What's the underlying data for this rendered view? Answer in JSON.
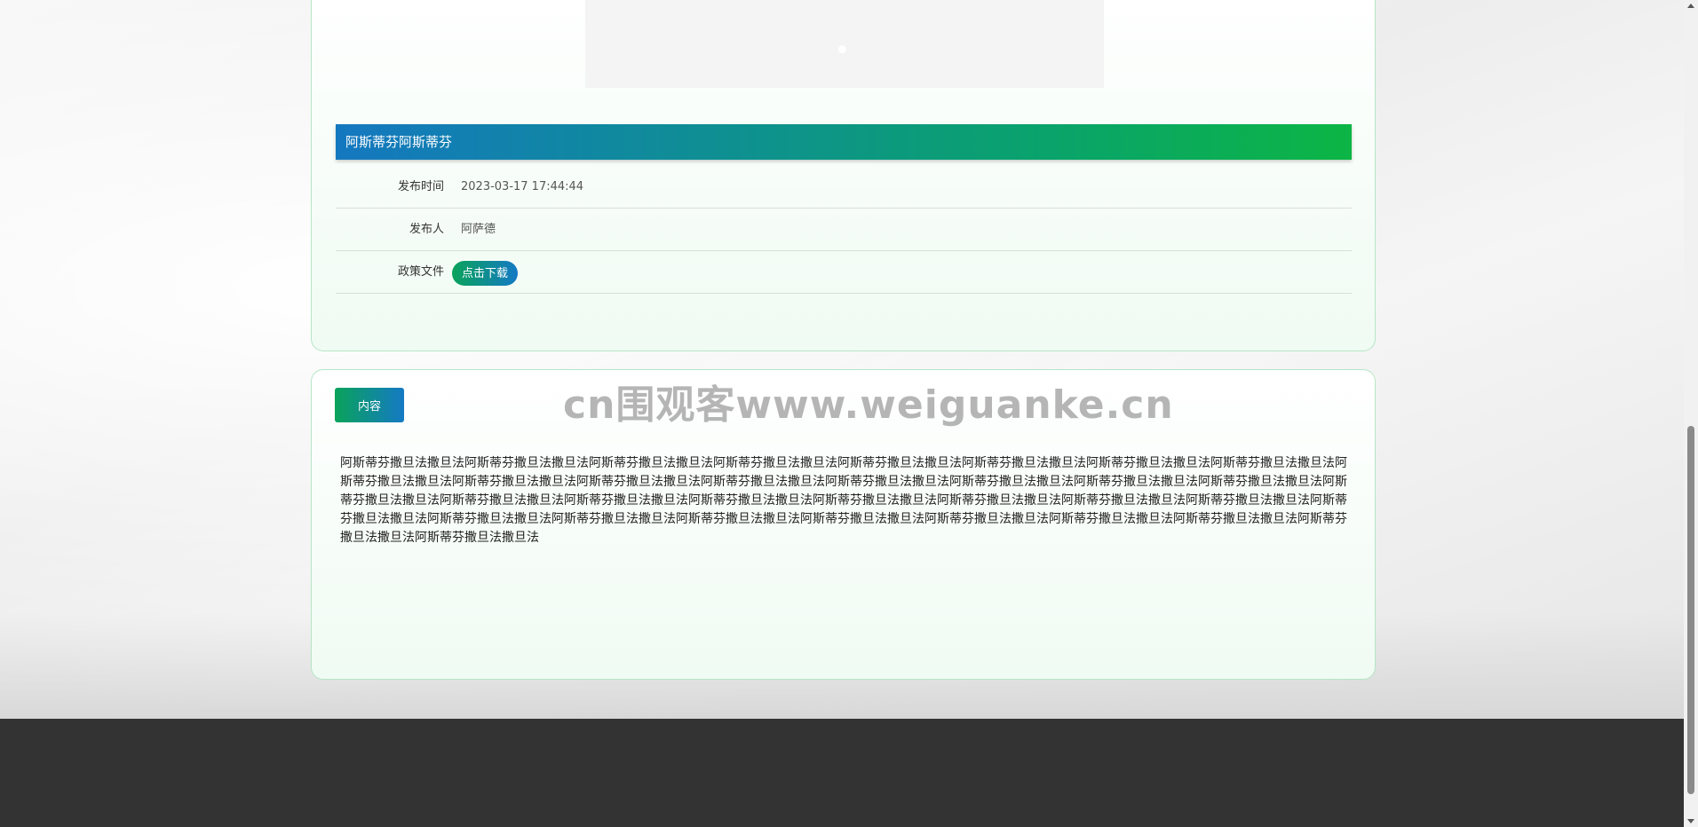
{
  "notice": {
    "title": "阿斯蒂芬阿斯蒂芬",
    "fields": [
      {
        "label": "发布时间",
        "value": "2023-03-17 17:44:44"
      },
      {
        "label": "发布人",
        "value": "阿萨德"
      },
      {
        "label": "政策文件",
        "button": "点击下载"
      }
    ]
  },
  "content": {
    "tab_label": "内容",
    "body": "阿斯蒂芬撒旦法撒旦法阿斯蒂芬撒旦法撒旦法阿斯蒂芬撒旦法撒旦法阿斯蒂芬撒旦法撒旦法阿斯蒂芬撒旦法撒旦法阿斯蒂芬撒旦法撒旦法阿斯蒂芬撒旦法撒旦法阿斯蒂芬撒旦法撒旦法阿斯蒂芬撒旦法撒旦法阿斯蒂芬撒旦法撒旦法阿斯蒂芬撒旦法撒旦法阿斯蒂芬撒旦法撒旦法阿斯蒂芬撒旦法撒旦法阿斯蒂芬撒旦法撒旦法阿斯蒂芬撒旦法撒旦法阿斯蒂芬撒旦法撒旦法阿斯蒂芬撒旦法撒旦法阿斯蒂芬撒旦法撒旦法阿斯蒂芬撒旦法撒旦法阿斯蒂芬撒旦法撒旦法阿斯蒂芬撒旦法撒旦法阿斯蒂芬撒旦法撒旦法阿斯蒂芬撒旦法撒旦法阿斯蒂芬撒旦法撒旦法阿斯蒂芬撒旦法撒旦法阿斯蒂芬撒旦法撒旦法阿斯蒂芬撒旦法撒旦法阿斯蒂芬撒旦法撒旦法阿斯蒂芬撒旦法撒旦法阿斯蒂芬撒旦法撒旦法阿斯蒂芬撒旦法撒旦法阿斯蒂芬撒旦法撒旦法阿斯蒂芬撒旦法撒旦法阿斯蒂芬撒旦法撒旦法"
  },
  "watermark": "cn围观客www.weiguanke.cn",
  "colors": {
    "accent_green": "#0cb545",
    "accent_blue": "#1478c0",
    "footer": "#333333",
    "card_border": "#b6e6c6"
  }
}
